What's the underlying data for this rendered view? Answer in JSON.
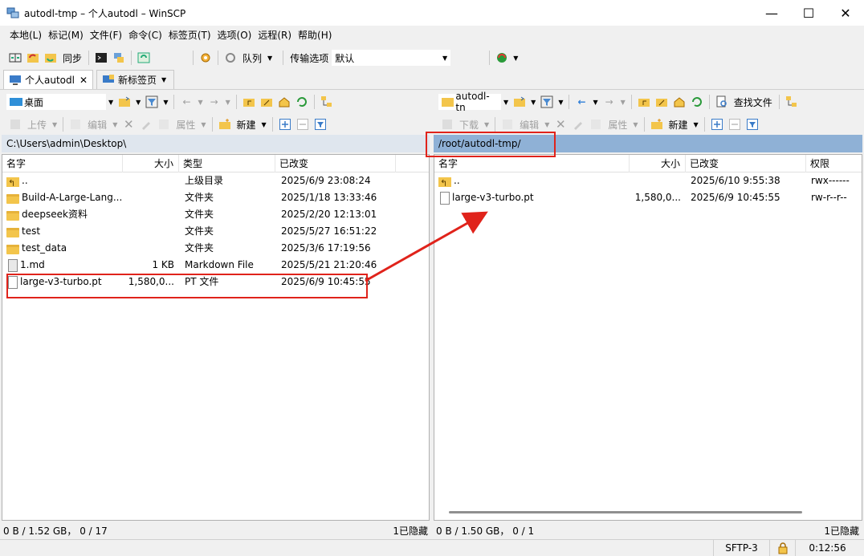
{
  "window": {
    "title": "autodl-tmp – 个人autodl – WinSCP",
    "minimize": "—",
    "maximize": "☐",
    "close": "✕"
  },
  "menu": [
    "本地(L)",
    "标记(M)",
    "文件(F)",
    "命令(C)",
    "标签页(T)",
    "选项(O)",
    "远程(R)",
    "帮助(H)"
  ],
  "toolbar": {
    "sync_label": "同步",
    "queue_label": "队列",
    "transfer_label": "传输选项",
    "transfer_value": "默认"
  },
  "tabs": [
    {
      "label": "个人autodl",
      "close": "✕"
    },
    {
      "label": "新标签页"
    }
  ],
  "left": {
    "drive": "桌面",
    "upload": "上传",
    "edit": "编辑",
    "props": "属性",
    "new": "新建",
    "path": "C:\\Users\\admin\\Desktop\\",
    "columns": {
      "name": "名字",
      "size": "大小",
      "type": "类型",
      "modified": "已改变"
    },
    "rows": [
      {
        "name": "..",
        "size": "",
        "type": "上级目录",
        "modified": "2025/6/9 23:08:24",
        "icon": "folder-up"
      },
      {
        "name": "Build-A-Large-Lang...",
        "size": "",
        "type": "文件夹",
        "modified": "2025/1/18 13:33:46",
        "icon": "folder"
      },
      {
        "name": "deepseek资料",
        "size": "",
        "type": "文件夹",
        "modified": "2025/2/20 12:13:01",
        "icon": "folder"
      },
      {
        "name": "test",
        "size": "",
        "type": "文件夹",
        "modified": "2025/5/27 16:51:22",
        "icon": "folder"
      },
      {
        "name": "test_data",
        "size": "",
        "type": "文件夹",
        "modified": "2025/3/6 17:19:56",
        "icon": "folder"
      },
      {
        "name": "1.md",
        "size": "1 KB",
        "type": "Markdown File",
        "modified": "2025/5/21 21:20:46",
        "icon": "md"
      },
      {
        "name": "large-v3-turbo.pt",
        "size": "1,580,0...",
        "type": "PT 文件",
        "modified": "2025/6/9 10:45:55",
        "icon": "file"
      }
    ],
    "status": "0 B / 1.52 GB， 0 / 17",
    "hidden": "1已隐藏"
  },
  "right": {
    "dir": "autodl-tn",
    "download": "下载",
    "edit": "编辑",
    "props": "属性",
    "new": "新建",
    "find": "查找文件",
    "path": "/root/autodl-tmp/",
    "columns": {
      "name": "名字",
      "size": "大小",
      "modified": "已改变",
      "rights": "权限"
    },
    "rows": [
      {
        "name": "..",
        "size": "",
        "modified": "2025/6/10 9:55:38",
        "rights": "rwx------",
        "icon": "folder-up"
      },
      {
        "name": "large-v3-turbo.pt",
        "size": "1,580,0...",
        "modified": "2025/6/9 10:45:55",
        "rights": "rw-r--r--",
        "icon": "file"
      }
    ],
    "status": "0 B / 1.50 GB， 0 / 1",
    "hidden": "1已隐藏"
  },
  "bottom": {
    "protocol": "SFTP-3",
    "time": "0:12:56"
  },
  "colors": {
    "annotation": "#e0231b",
    "path_active": "#8fb1d6",
    "path_inactive": "#dfe6ee"
  }
}
